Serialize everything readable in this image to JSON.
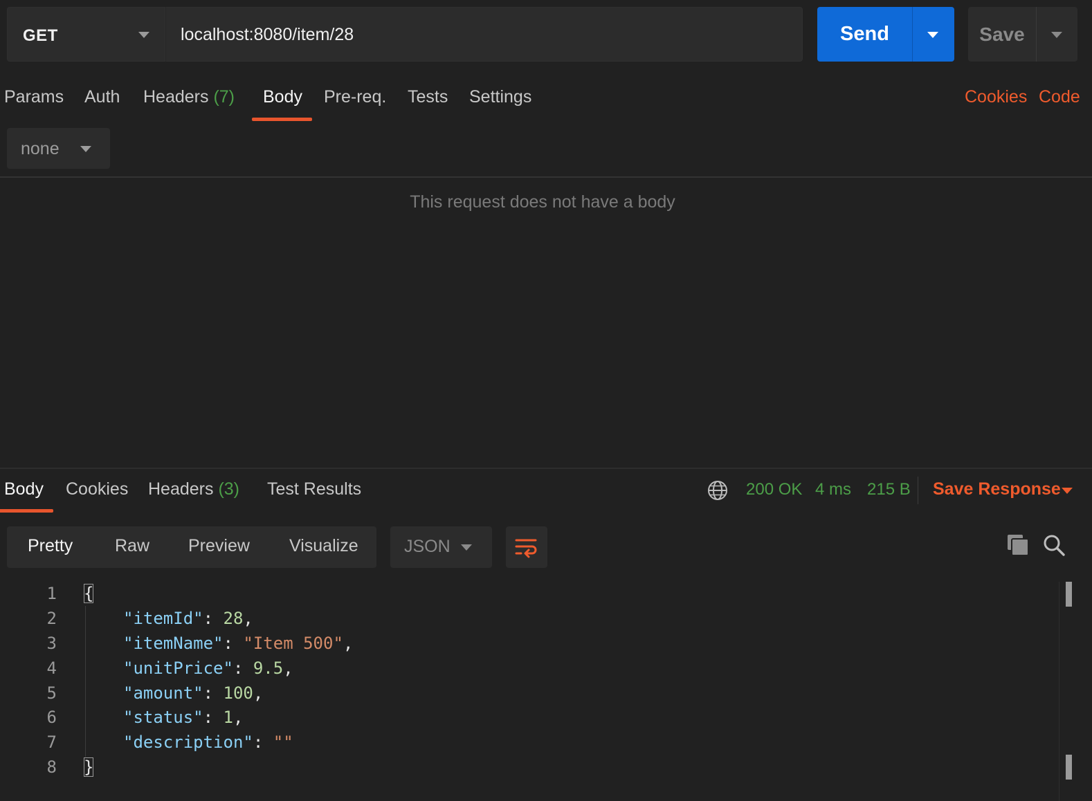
{
  "request": {
    "method": "GET",
    "url": "localhost:8080/item/28",
    "send_label": "Send",
    "save_label": "Save"
  },
  "request_tabs": {
    "params": "Params",
    "auth": "Auth",
    "headers": "Headers",
    "headers_count": "(7)",
    "body": "Body",
    "prereq": "Pre-req.",
    "tests": "Tests",
    "settings": "Settings",
    "cookies": "Cookies",
    "code": "Code",
    "active": "Body"
  },
  "body_panel": {
    "type": "none",
    "empty_message": "This request does not have a body"
  },
  "response_tabs": {
    "body": "Body",
    "cookies": "Cookies",
    "headers": "Headers",
    "headers_count": "(3)",
    "test_results": "Test Results",
    "active": "Body"
  },
  "response_meta": {
    "status": "200 OK",
    "time": "4 ms",
    "size": "215 B",
    "save_response": "Save Response"
  },
  "view_modes": {
    "pretty": "Pretty",
    "raw": "Raw",
    "preview": "Preview",
    "visualize": "Visualize",
    "active": "Pretty",
    "format": "JSON"
  },
  "response_body": {
    "line_numbers": [
      "1",
      "2",
      "3",
      "4",
      "5",
      "6",
      "7",
      "8"
    ],
    "open_brace": "{",
    "close_brace": "}",
    "entries": [
      {
        "key": "\"itemId\"",
        "value": "28",
        "type": "number",
        "comma": ","
      },
      {
        "key": "\"itemName\"",
        "value": "\"Item 500\"",
        "type": "string",
        "comma": ","
      },
      {
        "key": "\"unitPrice\"",
        "value": "9.5",
        "type": "number",
        "comma": ","
      },
      {
        "key": "\"amount\"",
        "value": "100",
        "type": "number",
        "comma": ","
      },
      {
        "key": "\"status\"",
        "value": "1",
        "type": "number",
        "comma": ","
      },
      {
        "key": "\"description\"",
        "value": "\"\"",
        "type": "string",
        "comma": ""
      }
    ]
  },
  "colors": {
    "accent_orange": "#ef5b2d",
    "send_blue": "#0f6ad8",
    "status_green": "#4c9e48",
    "json_key": "#8bd0f5",
    "json_number": "#b9d8a3",
    "json_string": "#d48b68"
  },
  "icons": [
    "chevron-down-icon",
    "globe-icon",
    "wrap-lines-icon",
    "copy-icon",
    "search-icon"
  ]
}
